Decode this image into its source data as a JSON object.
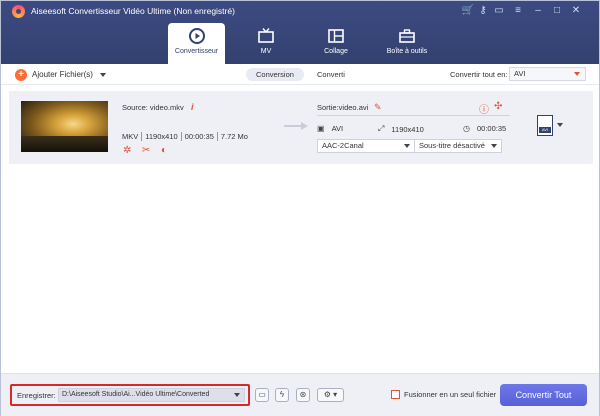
{
  "window": {
    "title": "Aiseesoft Convertisseur Vidéo Ultime (Non enregistré)"
  },
  "main_tabs": [
    {
      "label": "Convertisseur",
      "icon": "convert-icon"
    },
    {
      "label": "MV",
      "icon": "tv-icon"
    },
    {
      "label": "Collage",
      "icon": "collage-icon"
    },
    {
      "label": "Boîte à outils",
      "icon": "toolbox-icon"
    }
  ],
  "toolbar": {
    "add_files_label": "Ajouter Fichier(s)",
    "subtabs": [
      "Conversion",
      "Converti"
    ],
    "convert_all_label": "Convertir tout en:",
    "convert_all_value": "AVI"
  },
  "file": {
    "source": "Source: video.mkv",
    "format": "MKV",
    "resolution": "1190x410",
    "duration": "00:00:35",
    "size": "7.72 Mo",
    "output": "Sortie:video.avi",
    "out_format": "AVI",
    "out_resolution": "1190x410",
    "out_duration": "00:00:35",
    "audio": "AAC-2Canal",
    "subtitle": "Sous-titre désactivé",
    "badge": "AVI"
  },
  "bottom": {
    "save_label": "Enregistrer:",
    "save_path": "D:\\Aiseesoft Studio\\Ai...Vidéo Ultime\\Converted",
    "merge_label": "Fusionner en un seul fichier",
    "convert_button": "Convertir Tout"
  },
  "colors": {
    "titlebar": "#3c4a82",
    "accent": "#e0533a",
    "button": "#5f69de",
    "highlight_border": "#d42a2a"
  }
}
